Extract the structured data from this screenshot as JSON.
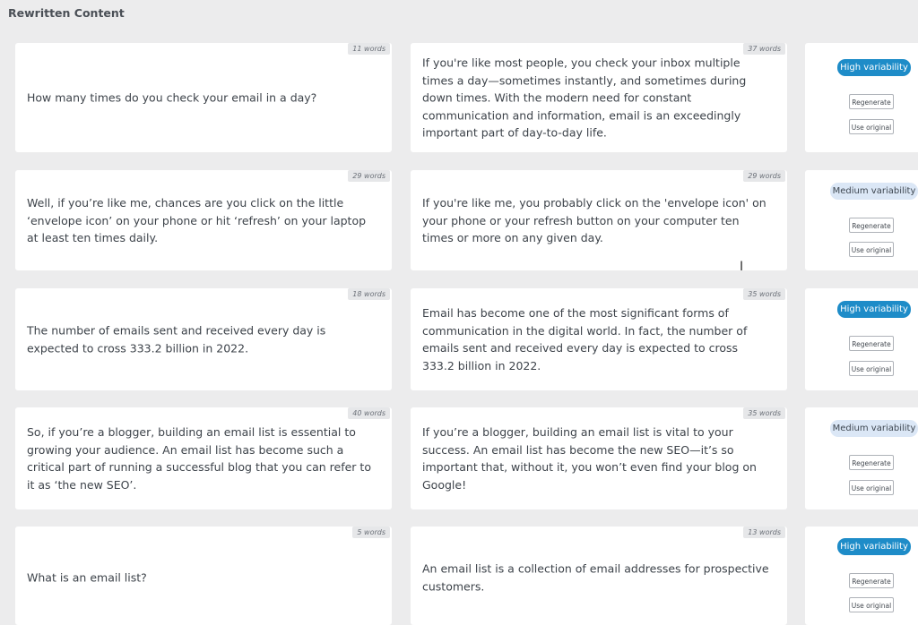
{
  "header": {
    "title": "Rewritten Content"
  },
  "rows": [
    {
      "original": {
        "text": "How many times do you check your email in a day?",
        "words": "11 words"
      },
      "rewritten": {
        "text": "If you're like most people, you check your inbox multiple times a day—sometimes instantly, and sometimes during down times. With the modern need for constant communication and information, email is an exceedingly important part of day-to-day life.",
        "words": "37 words"
      },
      "variability": "High variability",
      "regenerate": "Regenerate",
      "use_original": "Use original"
    },
    {
      "original": {
        "text": "Well, if you’re like me, chances are you click on the little ‘envelope icon’ on your phone or hit ‘refresh’ on your laptop at least ten times daily.",
        "words": "29 words"
      },
      "rewritten": {
        "text": "If you're like me, you probably click on the 'envelope icon' on your phone or your refresh button on your computer ten times or more on any given day.",
        "words": "29 words"
      },
      "variability": "Medium variability",
      "regenerate": "Regenerate",
      "use_original": "Use original"
    },
    {
      "original": {
        "text": "The number of emails sent and received every day is expected to cross 333.2 billion in 2022.",
        "words": "18 words"
      },
      "rewritten": {
        "text": "Email has become one of the most significant forms of communication in the digital world. In fact, the number of emails sent and received every day is expected to cross 333.2 billion in 2022.",
        "words": "35 words"
      },
      "variability": "High variability",
      "regenerate": "Regenerate",
      "use_original": "Use original"
    },
    {
      "original": {
        "text": "So, if you’re a blogger, building an email list is essential to growing your audience. An email list has become such a critical part of running a successful blog that you can refer to it as ‘the new SEO’.",
        "words": "40 words"
      },
      "rewritten": {
        "text": "If you’re a blogger, building an email list is vital to your success. An email list has become the new SEO—it’s so important that, without it, you won’t even find your blog on Google!",
        "words": "35 words"
      },
      "variability": "Medium variability",
      "regenerate": "Regenerate",
      "use_original": "Use original"
    },
    {
      "original": {
        "text": "What is an email list?",
        "words": "5 words"
      },
      "rewritten": {
        "text": "An email list is a collection of email addresses for prospective customers.",
        "words": "13 words"
      },
      "variability": "High variability",
      "regenerate": "Regenerate",
      "use_original": "Use original"
    }
  ]
}
